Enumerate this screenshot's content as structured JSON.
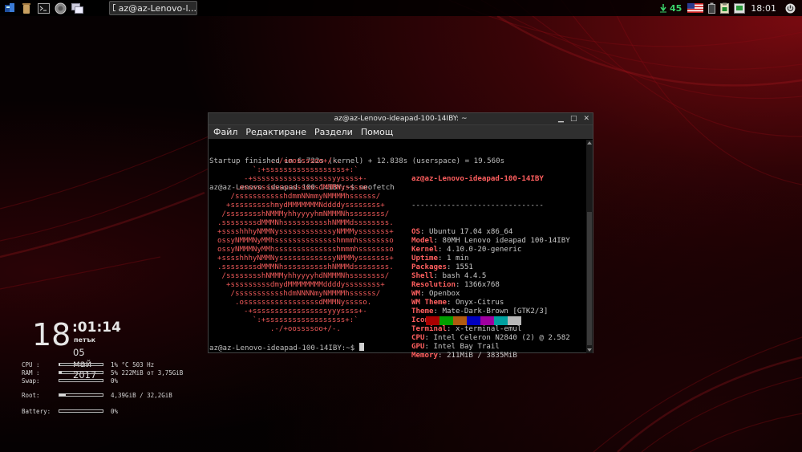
{
  "taskbar": {
    "window_title": "az@az-Lenovo-l...",
    "tray_number": "45",
    "clock": "18:01"
  },
  "terminal": {
    "title": "az@az-Lenovo-ideapad-100-14IBY: ~",
    "menu": [
      "Файл",
      "Редактиране",
      "Раздели",
      "Помощ"
    ],
    "startup_line": "Startup finished in 6.722s (kernel) + 12.838s (userspace) = 19.560s",
    "prompt_cmd": "az@az-Lenovo-ideapad-100-14IBY:~$ neofetch",
    "prompt_end": "az@az-Lenovo-ideapad-100-14IBY:~$ ",
    "logo": [
      "              .-/+oossssoo+/-.",
      "          `:+ssssssssssssssssss+:`",
      "        -+ssssssssssssssssssyyssss+-",
      "      .osssssssssssssssssdMMMNysssso.",
      "     /ssssssssssshdmmNNmmyNMMMMhssssss/",
      "    +ssssssssshmydMMMMMMMNddddyssssssss+",
      "   /sssssssshNMMMyhhyyyyhmNMMMNhssssssss/",
      "  .ssssssssdMMMNhsssssssssshNMMMdssssssss.",
      "  +sssshhhyNMMNyssssssssssssyNMMMysssssss+",
      "  ossyNMMMNyMMhsssssssssssssshmmmhssssssso",
      "  ossyNMMMNyMMhsssssssssssssshmmmhssssssso",
      "  +sssshhhyNMMNyssssssssssssyNMMMysssssss+",
      "  .ssssssssdMMMNhsssssssssshNMMMdssssssss.",
      "   /sssssssshNMMMyhhyyyyhdNMMMNhssssssss/",
      "    +sssssssssdmydMMMMMMMMddddyssssssss+",
      "     /ssssssssssshdmNNNNmyNMMMMhssssss/",
      "      .osssssssssssssssssdMMMNysssso.",
      "        -+sssssssssssssssssyyyssss+-",
      "          `:+ssssssssssssssssss+:`",
      "              .-/+oossssoo+/-."
    ],
    "info_header": "az@az-Lenovo-ideapad-100-14IBY",
    "info_separator": "------------------------------",
    "info": [
      {
        "key": "OS",
        "value": "Ubuntu 17.04 x86_64"
      },
      {
        "key": "Model",
        "value": "80MH Lenovo ideapad 100-14IBY"
      },
      {
        "key": "Kernel",
        "value": "4.10.0-20-generic"
      },
      {
        "key": "Uptime",
        "value": "1 min"
      },
      {
        "key": "Packages",
        "value": "1551"
      },
      {
        "key": "Shell",
        "value": "bash 4.4.5"
      },
      {
        "key": "Resolution",
        "value": "1366x768"
      },
      {
        "key": "WM",
        "value": "Openbox"
      },
      {
        "key": "WM Theme",
        "value": "Onyx-Citrus"
      },
      {
        "key": "Theme",
        "value": "Mate-Dark-Brown [GTK2/3]"
      },
      {
        "key": "Icons",
        "value": "Buuf3.22 [GTK2/3]"
      },
      {
        "key": "Terminal",
        "value": "x-terminal-emul"
      },
      {
        "key": "CPU",
        "value": "Intel Celeron N2840 (2) @ 2.582"
      },
      {
        "key": "GPU",
        "value": "Intel Bay Trail"
      },
      {
        "key": "Memory",
        "value": "211MiB / 3835MiB"
      }
    ],
    "swatch_colors": [
      "#aa0000",
      "#00a000",
      "#b05a10",
      "#0000c0",
      "#a000a0",
      "#00a0a0",
      "#b8b8b8"
    ]
  },
  "conky": {
    "hour": "18",
    "minsec": ":01:14",
    "weekday": "петък",
    "date": "05 май 2017",
    "stats": [
      {
        "label": "CPU :",
        "text": "1%  °C 503 Hz",
        "fill": 0.01
      },
      {
        "label": "RAM :",
        "text": "5% 222MiB от 3,75GiB",
        "fill": 0.05
      },
      {
        "label": "Swap:",
        "text": "0%",
        "fill": 0
      },
      {
        "label": "Root:",
        "text": "4,39GiB / 32,2GiB",
        "fill": 0.14
      },
      {
        "label": "Battery:",
        "text": "0%",
        "fill": 0
      }
    ]
  }
}
